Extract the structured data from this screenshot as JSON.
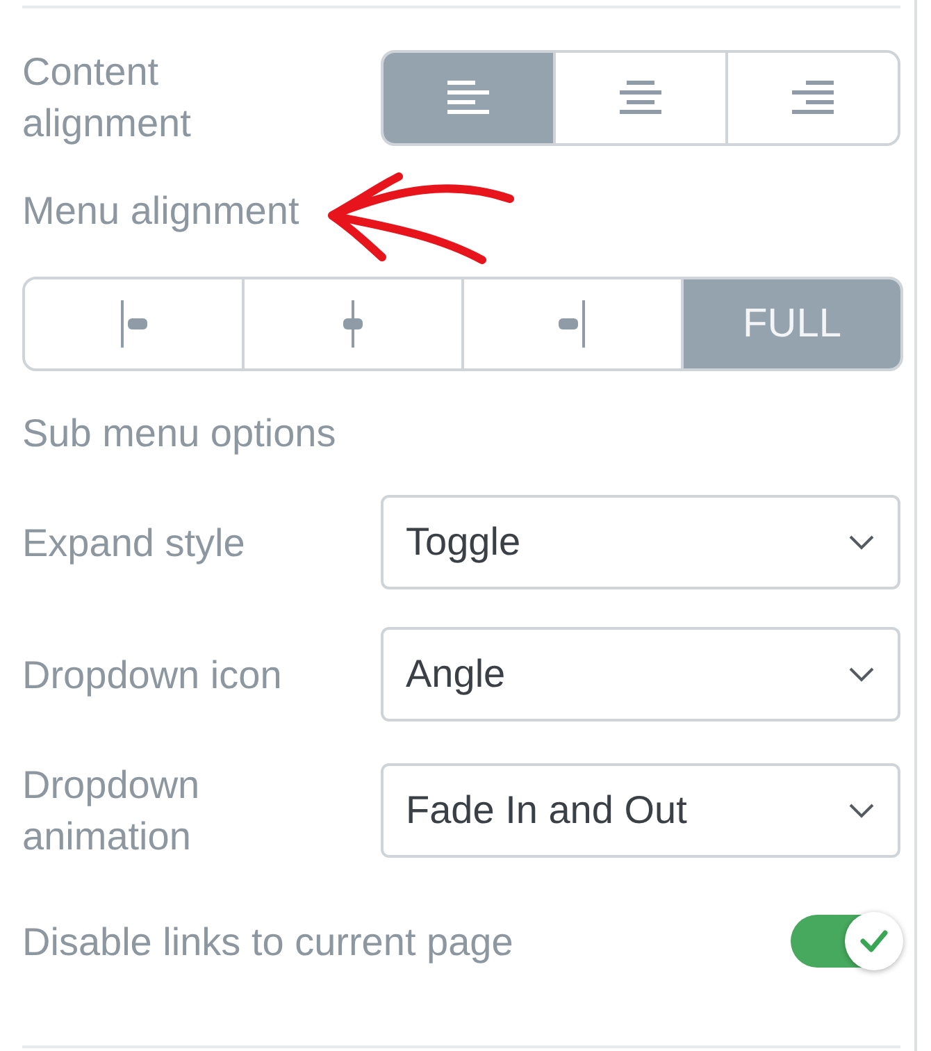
{
  "content_alignment": {
    "label": "Content alignment",
    "options": [
      {
        "kind": "left",
        "selected": true
      },
      {
        "kind": "center",
        "selected": false
      },
      {
        "kind": "right",
        "selected": false
      }
    ]
  },
  "menu_alignment": {
    "label": "Menu alignment",
    "options": [
      {
        "kind": "start",
        "selected": false
      },
      {
        "kind": "center",
        "selected": false
      },
      {
        "kind": "end",
        "selected": false
      },
      {
        "kind": "full",
        "label": "FULL",
        "selected": true
      }
    ]
  },
  "section_title": "Sub menu options",
  "selects": [
    {
      "label": "Expand style",
      "value": "Toggle"
    },
    {
      "label": "Dropdown icon",
      "value": "Angle"
    },
    {
      "label": "Dropdown animation",
      "value": "Fade In and Out"
    }
  ],
  "toggle": {
    "label": "Disable links to current page",
    "on": true
  }
}
